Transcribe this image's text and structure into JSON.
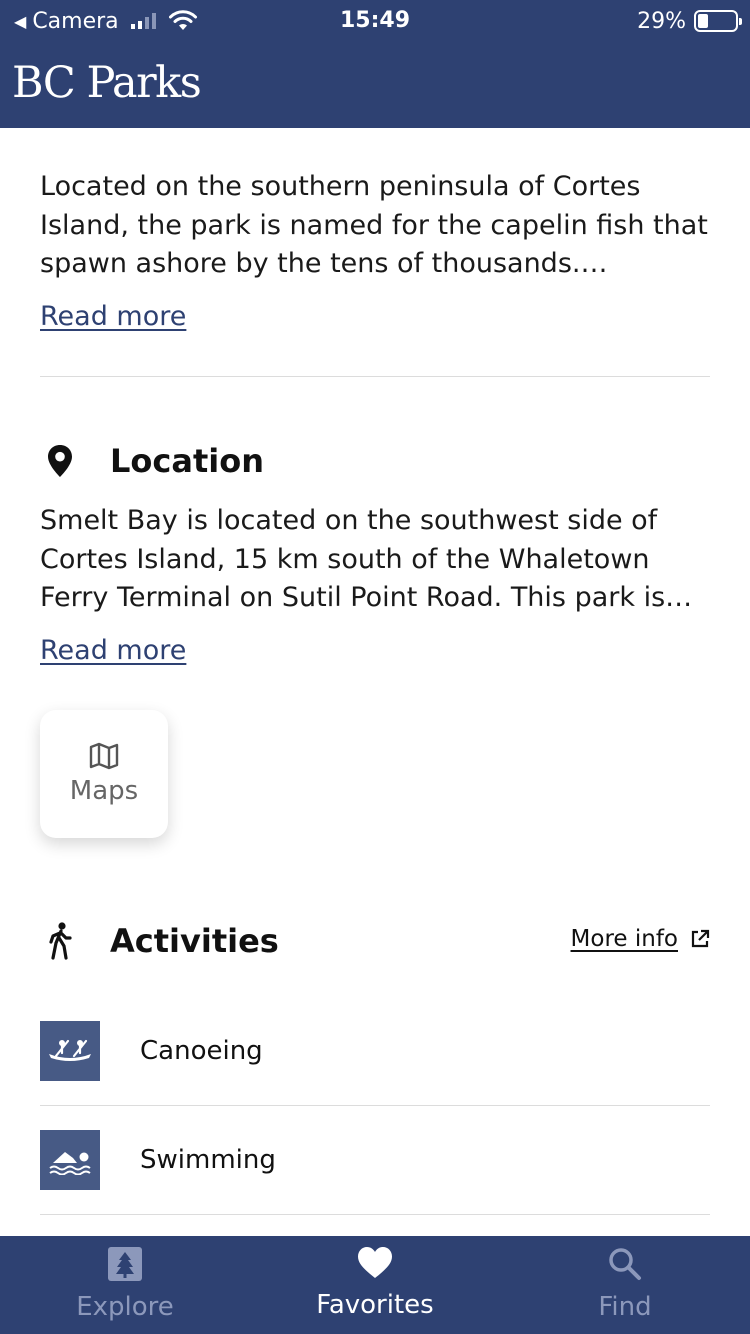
{
  "status_bar": {
    "back_label": "Camera",
    "time": "15:49",
    "battery_percent": "29%",
    "battery_level": 0.29
  },
  "header": {
    "brand": "BC Parks"
  },
  "description": {
    "text": "Located on the southern peninsula of Cortes Island, the park is named for the capelin fish that spawn ashore by the tens of thousands. Females…",
    "read_more": "Read more"
  },
  "location": {
    "title": "Location",
    "icon": "map-pin-icon",
    "text": "Smelt Bay is located on the southwest side of Cortes Island, 15 km south of the Whaletown Ferry Terminal on Sutil Point Road. This park is accessi…",
    "read_more": "Read more",
    "maps_label": "Maps"
  },
  "activities": {
    "title": "Activities",
    "icon": "hiker-icon",
    "more_info": "More info",
    "items": [
      {
        "label": "Canoeing",
        "icon": "canoe-icon"
      },
      {
        "label": "Swimming",
        "icon": "swimmer-icon"
      }
    ]
  },
  "tabs": [
    {
      "label": "Explore",
      "icon": "tree-icon",
      "active": false
    },
    {
      "label": "Favorites",
      "icon": "heart-icon",
      "active": true
    },
    {
      "label": "Find",
      "icon": "search-icon",
      "active": false
    }
  ],
  "colors": {
    "brand_blue": "#2e4172",
    "icon_tile": "#475a85",
    "inactive_tab": "#8c98bb"
  }
}
